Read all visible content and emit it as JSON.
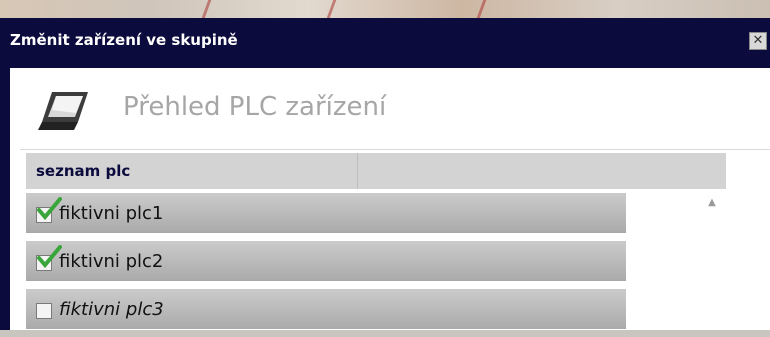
{
  "dialog": {
    "title": "Změnit zařízení ve skupině",
    "close_icon": "close-icon"
  },
  "header": {
    "title": "Přehled PLC zařízení",
    "icon": "device-icon"
  },
  "grid": {
    "column_header": "seznam plc",
    "rows": [
      {
        "label": "fiktivni plc1",
        "checked": true
      },
      {
        "label": "fiktivni plc2",
        "checked": true
      },
      {
        "label": "fiktivni plc3",
        "checked": false
      }
    ]
  },
  "colors": {
    "titlebar": "#0b0b3d",
    "header_text": "#a6a6a6",
    "check_green": "#3aa53a"
  }
}
